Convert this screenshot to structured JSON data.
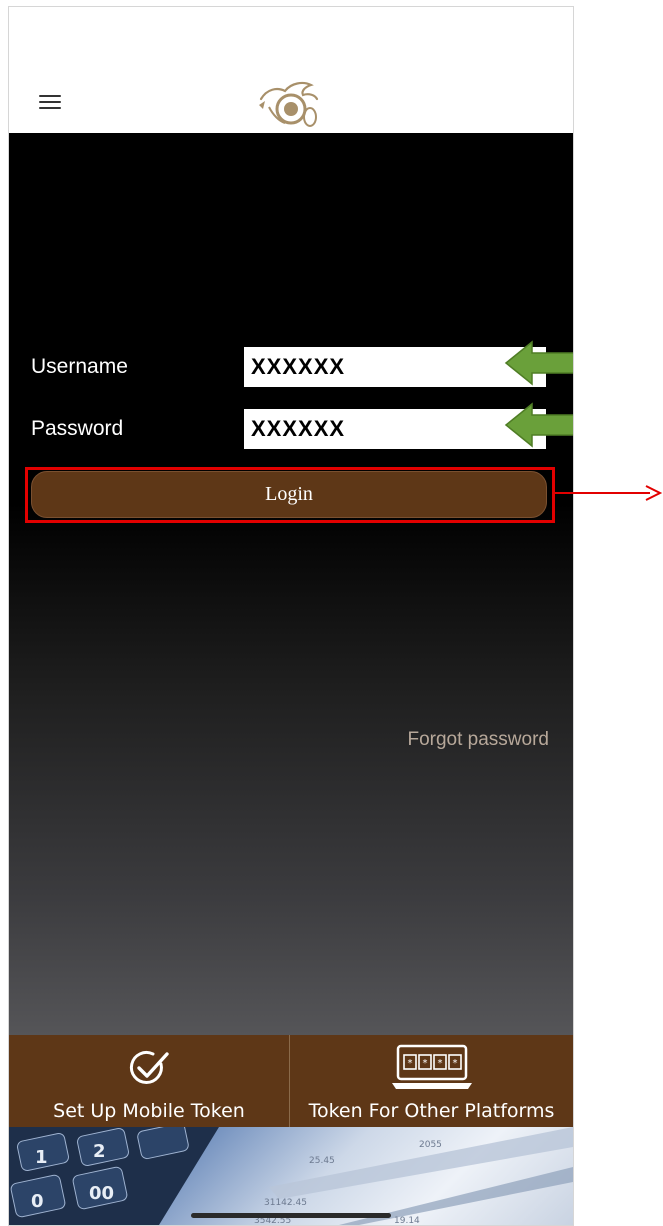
{
  "header": {
    "menu_icon": "hamburger-menu-icon",
    "logo": "dragon-logo"
  },
  "form": {
    "username_label": "Username",
    "username_value": "XXXXXX",
    "password_label": "Password",
    "password_value": "XXXXXX",
    "login_label": "Login",
    "forgot_label": "Forgot password"
  },
  "bottom_bar": {
    "items": [
      {
        "label": "Set Up Mobile Token",
        "icon": "checkmark-circle-icon"
      },
      {
        "label": "Token For Other Platforms",
        "icon": "laptop-token-icon"
      }
    ]
  },
  "annotations": {
    "arrow_color": "#6aa03a",
    "highlight_color": "#e20000"
  },
  "colors": {
    "brand_brown": "#5e3717",
    "forgot_text": "#b7a89a"
  }
}
